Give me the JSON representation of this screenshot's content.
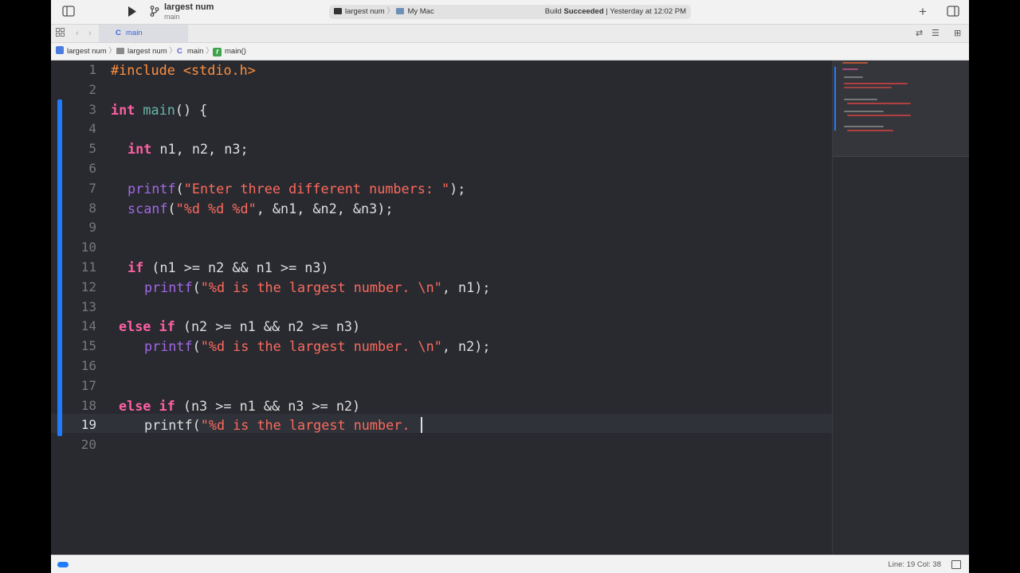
{
  "toolbar": {
    "project_name": "largest num",
    "branch": "main",
    "scheme": "largest num",
    "destination": "My Mac",
    "build_prefix": "Build ",
    "build_status": "Succeeded",
    "build_time": " | Yesterday at 12:02 PM"
  },
  "tab": {
    "lang_glyph": "C",
    "label": "main"
  },
  "jumpbar": {
    "items": [
      "largest num",
      "largest num",
      "main",
      "main()"
    ],
    "lang_glyph": "C",
    "func_glyph": "f"
  },
  "editor": {
    "line_numbers": [
      "1",
      "2",
      "3",
      "4",
      "5",
      "6",
      "7",
      "8",
      "9",
      "10",
      "11",
      "12",
      "13",
      "14",
      "15",
      "16",
      "17",
      "18",
      "19",
      "20"
    ],
    "current_line": 19,
    "tokens": {
      "l1_include": "#include <stdio.h>",
      "l3_int": "int",
      "l3_main": "main",
      "l3_rest": "() {",
      "l5_int": "int",
      "l5_rest": " n1, n2, n3;",
      "l7_fn": "printf",
      "l7_open": "(",
      "l7_str": "\"Enter three different numbers: \"",
      "l7_close": ");",
      "l8_fn": "scanf",
      "l8_open": "(",
      "l8_str": "\"%d %d %d\"",
      "l8_rest": ", &n1, &n2, &n3);",
      "l11_if": "if",
      "l11_rest": " (n1 >= n2 && n1 >= n3)",
      "l12_fn": "printf",
      "l12_open": "(",
      "l12_str": "\"%d is the largest number. \\n\"",
      "l12_rest": ", n1);",
      "l14_else": "else",
      "l14_if": "if",
      "l14_rest": " (n2 >= n1 && n2 >= n3)",
      "l15_fn": "printf",
      "l15_open": "(",
      "l15_str": "\"%d is the largest number. \\n\"",
      "l15_rest": ", n2);",
      "l18_else": "else",
      "l18_if": "if",
      "l18_rest": " (n3 >= n1 && n3 >= n2)",
      "l19_fn": "printf",
      "l19_open": "(",
      "l19_str": "\"%d is the largest number. "
    }
  },
  "statusbar": {
    "position": "Line: 19  Col: 38"
  },
  "colors": {
    "keyword": "#fc5fa3",
    "preprocessor": "#fd8f3f",
    "string": "#fc6a5d",
    "function": "#a167e6",
    "declaration": "#67b7a4",
    "change_bar": "#1f7cff"
  },
  "icons": [
    "sidebar-toggle-icon",
    "run-icon",
    "branch-icon",
    "add-icon",
    "inspector-toggle-icon",
    "grid-icon",
    "back-icon",
    "forward-icon",
    "refresh-icon",
    "related-icon",
    "split-icon",
    "terminal-icon",
    "mac-icon",
    "folder-icon",
    "app-icon",
    "func-icon"
  ]
}
